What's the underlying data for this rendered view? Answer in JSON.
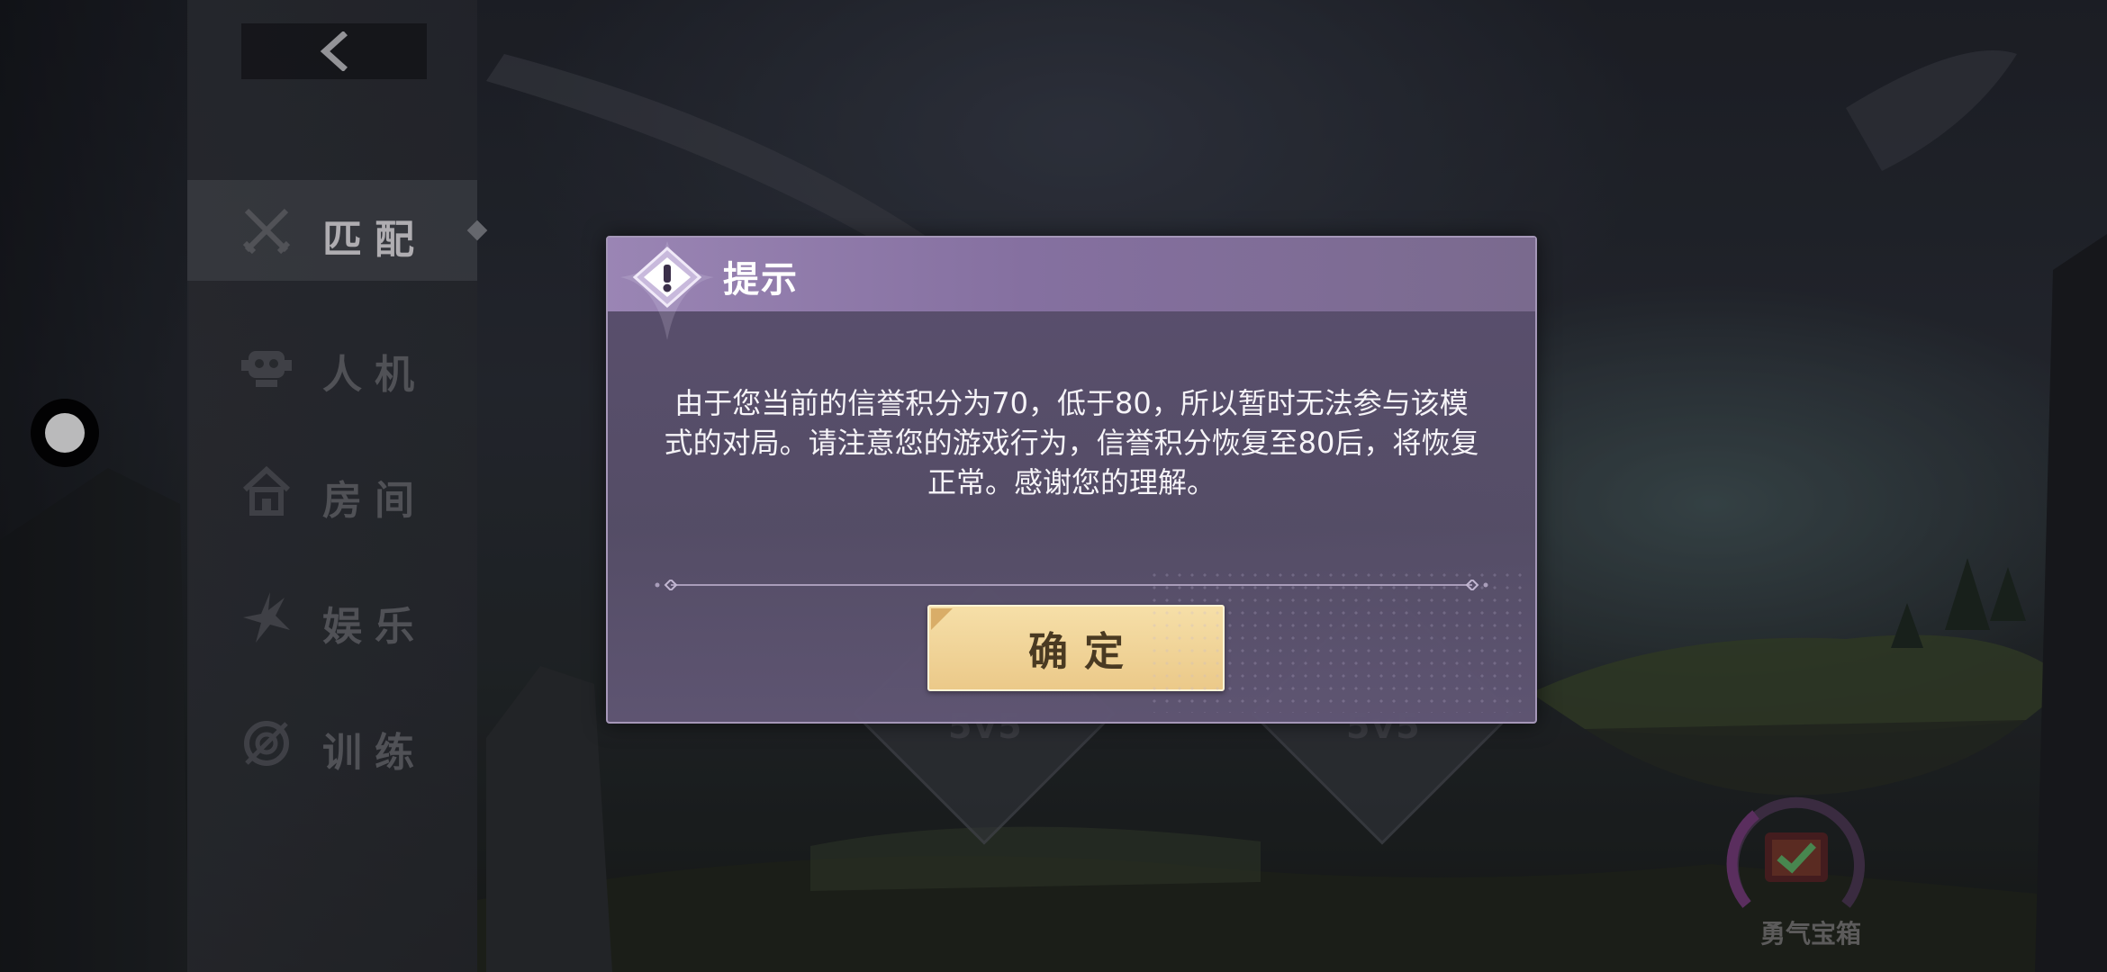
{
  "sidebar": {
    "back_label": "",
    "items": [
      {
        "label": "匹配",
        "active": true
      },
      {
        "label": "人机",
        "active": false
      },
      {
        "label": "房间",
        "active": false
      },
      {
        "label": "娱乐",
        "active": false
      },
      {
        "label": "训练",
        "active": false
      }
    ]
  },
  "mode_cards": [
    {
      "label": "5v5"
    },
    {
      "label": "5v5"
    }
  ],
  "chest": {
    "label": "勇气宝箱"
  },
  "dialog": {
    "title": "提示",
    "message": "由于您当前的信誉积分为70，低于80，所以暂时无法参与该模式的对局。请注意您的游戏行为，信誉积分恢复至80后，将恢复正常。感谢您的理解。",
    "confirm_label": "确定"
  },
  "colors": {
    "dialog_bg": "#5c5070",
    "header_bg": "#9a85b4",
    "confirm_bg": "#f0d49a",
    "confirm_text": "#4a3a22"
  }
}
